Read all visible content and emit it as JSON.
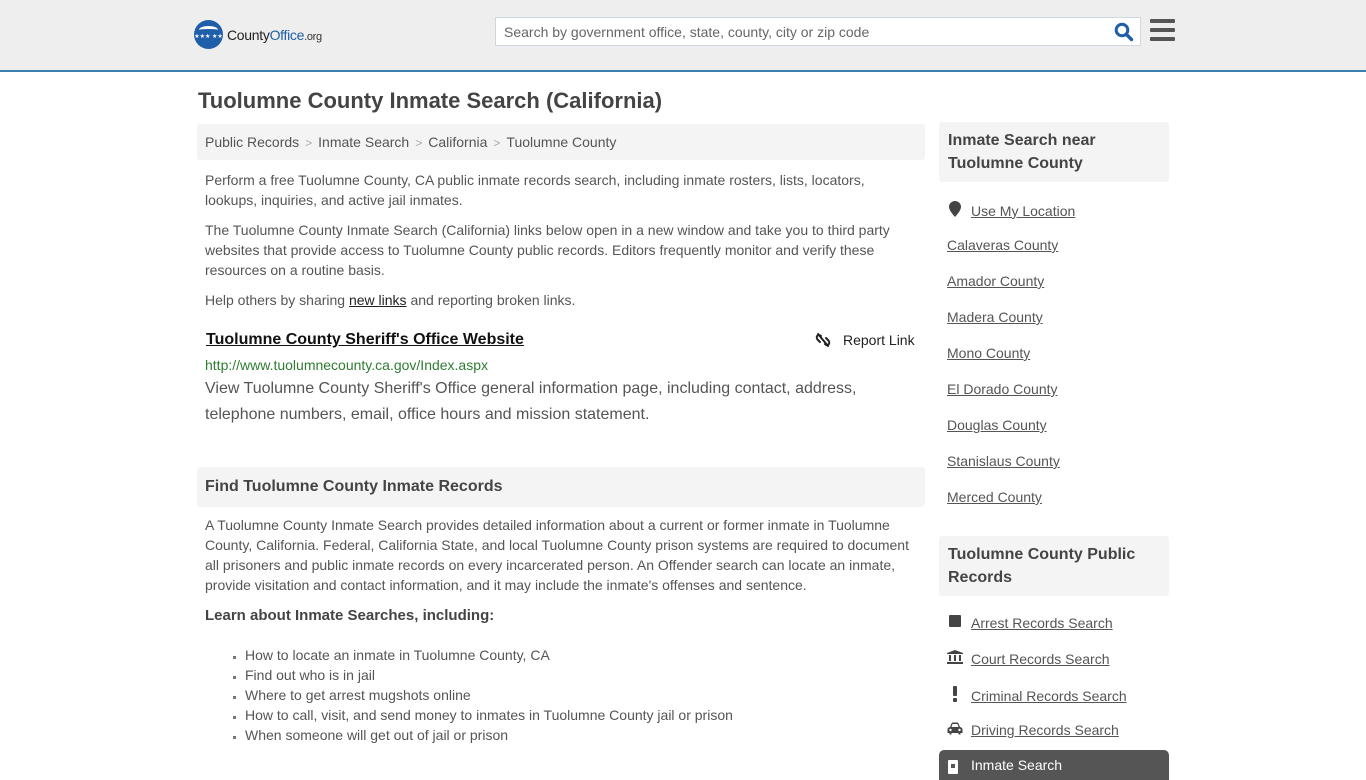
{
  "header": {
    "logo": {
      "text_part1": "County",
      "text_part2": "Office",
      "text_part3": ".org",
      "stars": "★★★ ★★",
      "brand_color": "#1f5ea8"
    },
    "search": {
      "placeholder": "Search by government office, state, county, city or zip code",
      "value": ""
    },
    "search_icon": "search-icon",
    "menu_icon": "hamburger-menu-icon",
    "accent_color": "#3a7fb0"
  },
  "page": {
    "title": "Tuolumne County Inmate Search (California)",
    "breadcrumb": [
      {
        "label": "Public Records"
      },
      {
        "label": "Inmate Search"
      },
      {
        "label": "California"
      },
      {
        "label": "Tuolumne County"
      }
    ],
    "breadcrumb_separator": ">",
    "intro": [
      "Perform a free Tuolumne County, CA public inmate records search, including inmate rosters, lists, locators, lookups, inquiries, and active jail inmates.",
      "The Tuolumne County Inmate Search (California) links below open in a new window and take you to third party websites that provide access to Tuolumne County public records. Editors frequently monitor and verify these resources on a routine basis."
    ],
    "help": {
      "before": "Help others by sharing ",
      "link": "new links",
      "after": " and reporting broken links."
    }
  },
  "results": [
    {
      "title": "Tuolumne County Sheriff's Office Website",
      "url": "http://www.tuolumnecounty.ca.gov/Index.aspx",
      "description": "View Tuolumne County Sheriff's Office general information page, including contact, address, telephone numbers, email, office hours and mission statement.",
      "report_label": "Report Link"
    }
  ],
  "find_section": {
    "heading": "Find Tuolumne County Inmate Records",
    "body": "A Tuolumne County Inmate Search provides detailed information about a current or former inmate in Tuolumne County, California. Federal, California State, and local Tuolumne County prison systems are required to document all prisoners and public inmate records on every incarcerated person. An Offender search can locate an inmate, provide visitation and contact information, and it may include the inmate's offenses and sentence.",
    "learn_heading": "Learn about Inmate Searches, including:",
    "bullets": [
      "How to locate an inmate in Tuolumne County, CA",
      "Find out who is in jail",
      "Where to get arrest mugshots online",
      "How to call, visit, and send money to inmates in Tuolumne County jail or prison",
      "When someone will get out of jail or prison"
    ]
  },
  "sidebar": {
    "nearby": {
      "heading": "Inmate Search near Tuolumne County",
      "use_location": "Use My Location",
      "counties": [
        "Calaveras County",
        "Amador County",
        "Madera County",
        "Mono County",
        "El Dorado County",
        "Douglas County",
        "Stanislaus County",
        "Merced County"
      ]
    },
    "public_records": {
      "heading": "Tuolumne County Public Records",
      "items": [
        {
          "label": "Arrest Records Search",
          "icon": "square-icon"
        },
        {
          "label": "Court Records Search",
          "icon": "courthouse-icon"
        },
        {
          "label": "Criminal Records Search",
          "icon": "exclamation-icon"
        },
        {
          "label": "Driving Records Search",
          "icon": "car-icon"
        },
        {
          "label": "Inmate Search",
          "icon": "jail-door-icon",
          "active": true
        }
      ]
    }
  }
}
